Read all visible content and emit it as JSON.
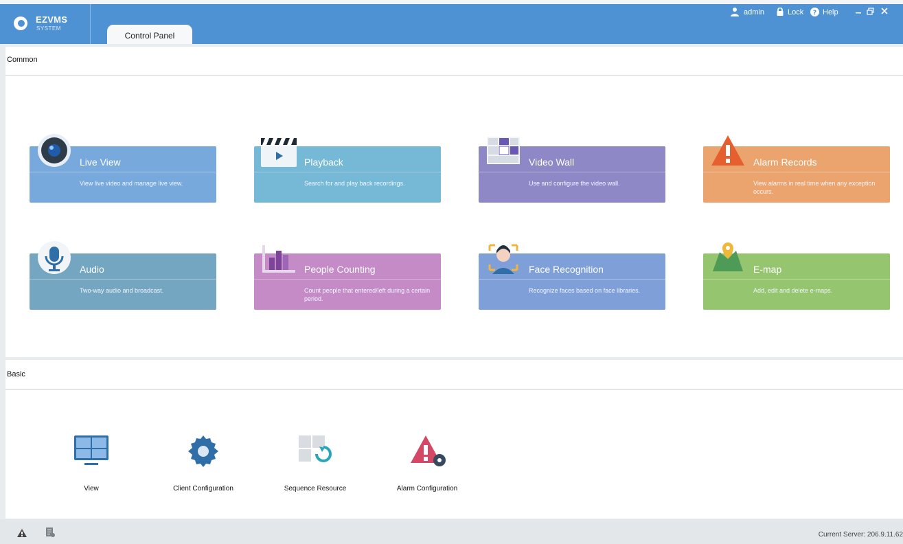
{
  "app": {
    "title": "EZVMS",
    "subtitle": "SYSTEM"
  },
  "tab": {
    "label": "Control Panel"
  },
  "topbar": {
    "user": "admin",
    "lock": "Lock",
    "help": "Help"
  },
  "sections": {
    "common": "Common",
    "basic": "Basic"
  },
  "cards": [
    {
      "title": "Live View",
      "desc": "View live video and manage live view.",
      "color": "#78a9dc"
    },
    {
      "title": "Playback",
      "desc": "Search for and play back recordings.",
      "color": "#75b9d7"
    },
    {
      "title": "Video Wall",
      "desc": "Use and configure the video wall.",
      "color": "#8e88c7"
    },
    {
      "title": "Alarm Records",
      "desc": "View alarms in real time when any exception occurs.",
      "color": "#eba46d"
    },
    {
      "title": "Audio",
      "desc": "Two-way audio and broadcast.",
      "color": "#74a6c1"
    },
    {
      "title": "People Counting",
      "desc": "Count people that entered/left during a certain period.",
      "color": "#c48bc7"
    },
    {
      "title": "Face Recognition",
      "desc": "Recognize faces based on face libraries.",
      "color": "#7f9fd8"
    },
    {
      "title": "E-map",
      "desc": "Add, edit and delete e-maps.",
      "color": "#95c56f"
    }
  ],
  "basic": [
    {
      "label": "View"
    },
    {
      "label": "Client Configuration"
    },
    {
      "label": "Sequence Resource"
    },
    {
      "label": "Alarm Configuration"
    }
  ],
  "status": {
    "server": "Current Server: 206.9.11.62"
  },
  "icons": {
    "logo": "logo-icon",
    "user": "user-icon",
    "lock": "lock-icon",
    "help": "help-icon",
    "minimize": "minimize-icon",
    "restore": "restore-icon",
    "close": "close-icon",
    "warning": "warning-icon",
    "log": "log-icon"
  }
}
